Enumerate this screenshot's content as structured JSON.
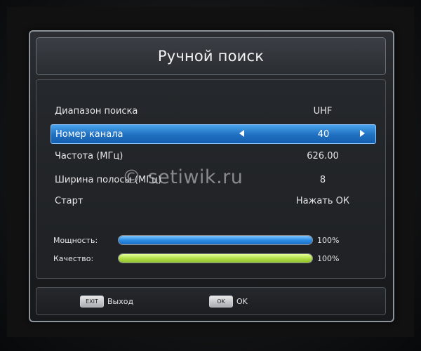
{
  "dialog": {
    "title": "Ручной поиск"
  },
  "settings": [
    {
      "label": "Диапазон поиска",
      "value": "UHF",
      "selected": false
    },
    {
      "label": "Номер канала",
      "value": "40",
      "selected": true
    },
    {
      "label": "Частота (МГц)",
      "value": "626.00",
      "selected": false
    },
    {
      "label": "Ширина полосы (МГц)",
      "value": "8",
      "selected": false
    },
    {
      "label": "Старт",
      "value": "Нажать ОК",
      "selected": false
    }
  ],
  "meters": {
    "power": {
      "label": "Мощность:",
      "percent_text": "100%",
      "level": 1.0,
      "color": "#2d8ee6"
    },
    "quality": {
      "label": "Качество:",
      "percent_text": "100%",
      "level": 1.0,
      "color": "#b4e04a"
    }
  },
  "footer": {
    "exit_key": "EXIT",
    "exit_label": "Выход",
    "ok_key": "OK",
    "ok_label": "OK"
  },
  "watermark": "© setiwik.ru",
  "colors": {
    "selected_row": "#1f6fc0",
    "panel_border": "#8d939b"
  }
}
